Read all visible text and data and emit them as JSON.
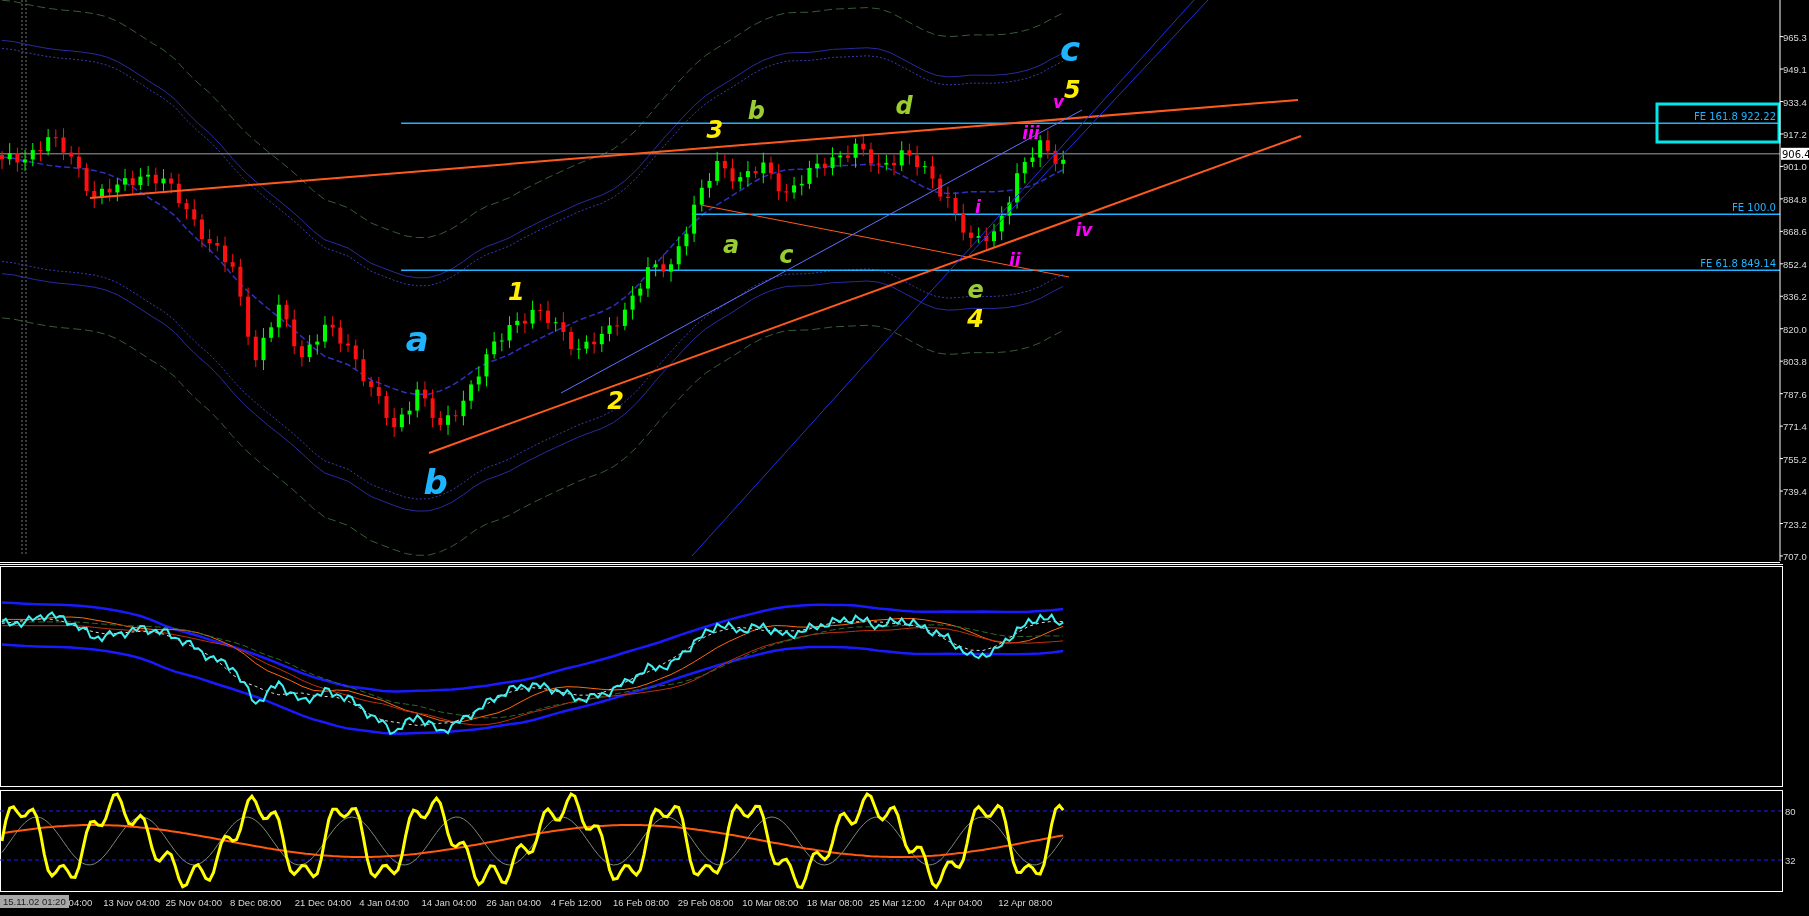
{
  "main_chart": {
    "price_axis": [
      "965.3",
      "949.1",
      "933.4",
      "917.2",
      "901.0",
      "884.8",
      "868.6",
      "852.4",
      "836.2",
      "820.0",
      "803.8",
      "787.6",
      "771.4",
      "755.2",
      "739.4",
      "723.2",
      "707.0"
    ],
    "fib_levels": [
      {
        "label": "FE 161.8 922.22"
      },
      {
        "label": "FE 100.0"
      },
      {
        "label": "FE 61.8 849.14"
      }
    ],
    "price_tag": "906.4",
    "wave_labels": [
      {
        "kind": "major",
        "text": "c",
        "color": "#1eb4ff"
      },
      {
        "kind": "minor",
        "text": "5",
        "color": "#ffee00"
      },
      {
        "kind": "minor",
        "text": "3",
        "color": "#ffee00"
      },
      {
        "kind": "minor",
        "text": "b",
        "color": "#9acd32"
      },
      {
        "kind": "minor",
        "text": "d",
        "color": "#9acd32"
      },
      {
        "kind": "sub",
        "text": "iii",
        "color": "#ff00ff"
      },
      {
        "kind": "sub",
        "text": "v",
        "color": "#ff00ff"
      },
      {
        "kind": "sub",
        "text": "iv",
        "color": "#ff00ff"
      },
      {
        "kind": "sub",
        "text": "i",
        "color": "#ff00ff"
      },
      {
        "kind": "sub",
        "text": "ii",
        "color": "#ff00ff"
      },
      {
        "kind": "minor",
        "text": "e",
        "color": "#9acd32"
      },
      {
        "kind": "minor",
        "text": "4",
        "color": "#ffee00"
      },
      {
        "kind": "minor",
        "text": "a",
        "color": "#9acd32"
      },
      {
        "kind": "minor",
        "text": "c",
        "color": "#9acd32"
      },
      {
        "kind": "minor",
        "text": "1",
        "color": "#ffee00"
      },
      {
        "kind": "major",
        "text": "a",
        "color": "#1eb4ff"
      },
      {
        "kind": "minor",
        "text": "2",
        "color": "#ffee00"
      },
      {
        "kind": "major",
        "text": "b",
        "color": "#1eb4ff"
      }
    ]
  },
  "oscillator_panel": {
    "levels": [
      {
        "label": "80"
      },
      {
        "label": "32"
      }
    ]
  },
  "time_axis": {
    "cursor_time": "15.11.02 01:20",
    "labels": [
      "04:00",
      "13 Nov 04:00",
      "25 Nov 04:00",
      "8 Dec 08:00",
      "21 Dec 04:00",
      "4 Jan 04:00",
      "14 Jan 04:00",
      "26 Jan 04:00",
      "4 Feb 12:00",
      "16 Feb 08:00",
      "29 Feb 08:00",
      "10 Mar 08:00",
      "18 Mar 08:00",
      "25 Mar 12:00",
      "4 Apr 04:00",
      "12 Apr 08:00"
    ]
  }
}
